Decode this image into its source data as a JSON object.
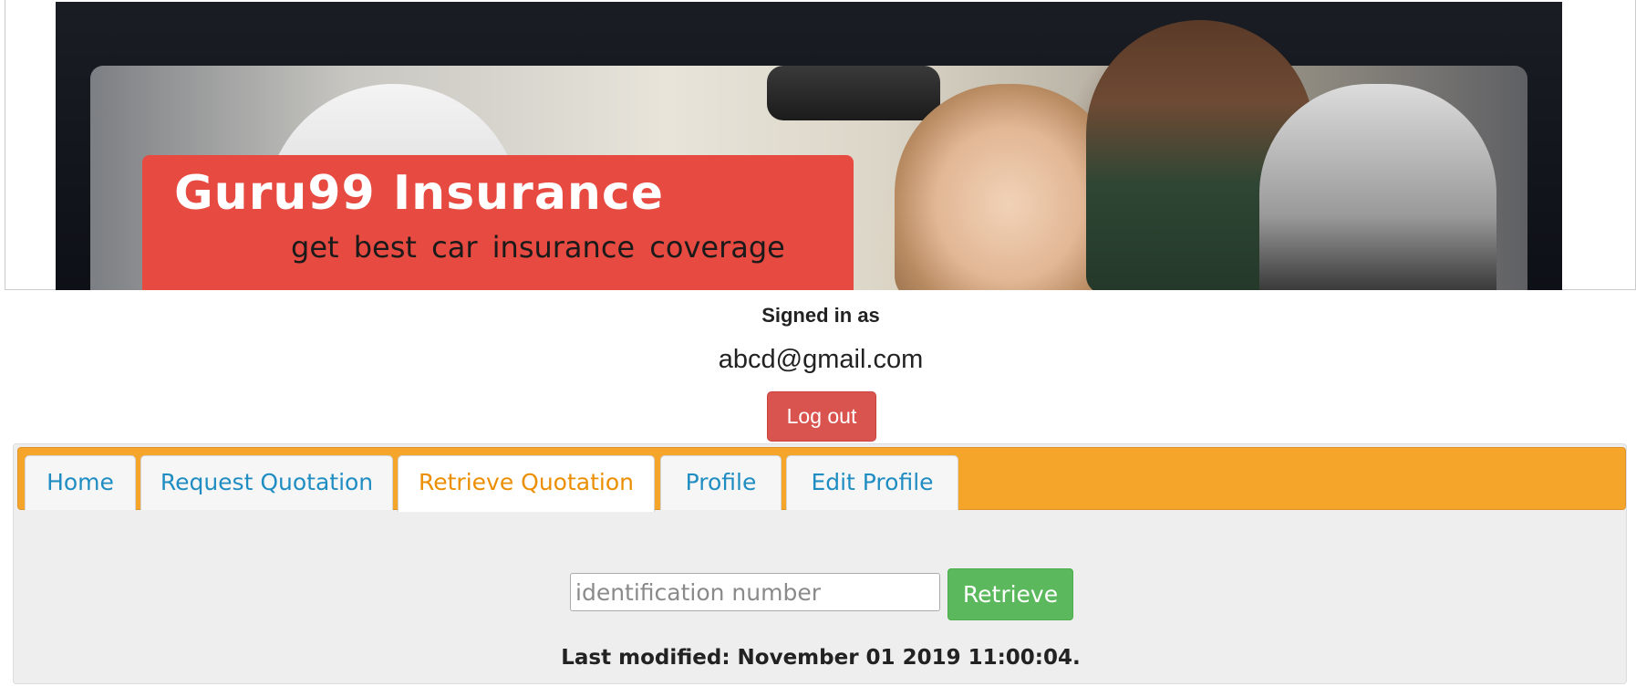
{
  "banner": {
    "title": "Guru99 Insurance",
    "subtitle": "get best car insurance coverage",
    "colors": {
      "label_bg": "#e64a41",
      "frame_bg": "#0d1016"
    }
  },
  "session": {
    "signed_in_label": "Signed in as",
    "email": "abcd@gmail.com",
    "logout_label": "Log out"
  },
  "tabs": [
    {
      "label": "Home",
      "active": false
    },
    {
      "label": "Request Quotation",
      "active": false
    },
    {
      "label": "Retrieve Quotation",
      "active": true
    },
    {
      "label": "Profile",
      "active": false
    },
    {
      "label": "Edit Profile",
      "active": false
    }
  ],
  "retrieve": {
    "input_value": "",
    "input_placeholder": "identification number",
    "button_label": "Retrieve"
  },
  "footer": {
    "last_modified": "Last modified: November 01 2019 11:00:04."
  },
  "colors": {
    "tab_bar": "#f5a52a",
    "tab_text": "#1f8dc2",
    "tab_active_text": "#eb8f00",
    "logout_button": "#d9534f",
    "retrieve_button": "#5cb85c",
    "panel_bg": "#eeeeee"
  }
}
